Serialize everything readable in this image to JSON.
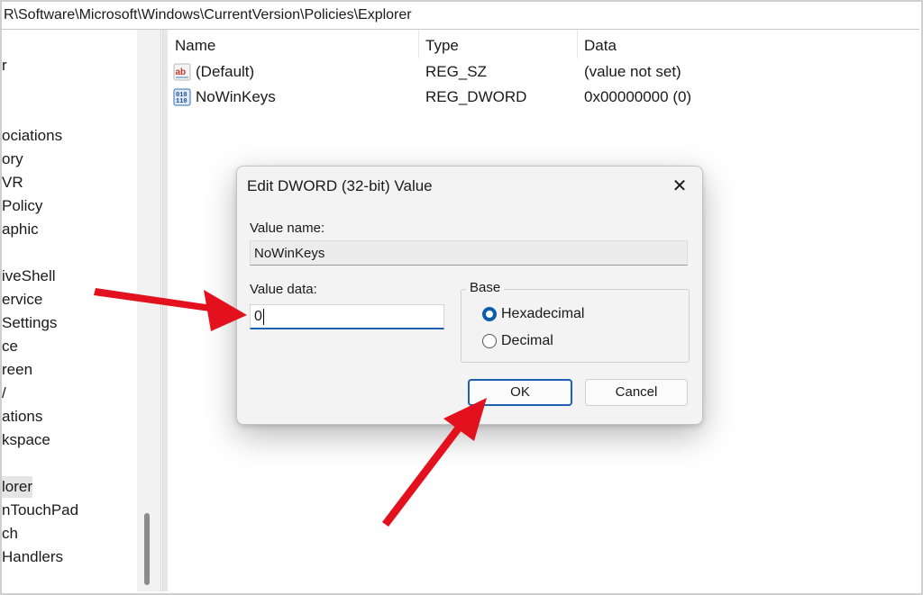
{
  "address_path": "R\\Software\\Microsoft\\Windows\\CurrentVersion\\Policies\\Explorer",
  "tree_items": [
    "r",
    "ociations",
    "ory",
    "VR",
    "Policy",
    "aphic",
    "iveShell",
    "ervice",
    " Settings",
    "ce",
    "reen",
    "/",
    "ations",
    "kspace",
    "lorer",
    "nTouchPad",
    "ch",
    " Handlers"
  ],
  "selected_tree_item": "lorer",
  "list": {
    "columns": [
      "Name",
      "Type",
      "Data"
    ],
    "rows": [
      {
        "icon": "string-value-icon",
        "name": "(Default)",
        "type": "REG_SZ",
        "data": "(value not set)"
      },
      {
        "icon": "binary-value-icon",
        "name": "NoWinKeys",
        "type": "REG_DWORD",
        "data": "0x00000000 (0)"
      }
    ]
  },
  "dialog": {
    "title": "Edit DWORD (32-bit) Value",
    "close_glyph": "✕",
    "value_name_label": "Value name:",
    "value_name": "NoWinKeys",
    "value_data_label": "Value data:",
    "value_data": "0",
    "base_label": "Base",
    "base_options": [
      "Hexadecimal",
      "Decimal"
    ],
    "base_selected": "Hexadecimal",
    "ok_label": "OK",
    "cancel_label": "Cancel"
  },
  "colors": {
    "annotation_arrow": "#e3101d",
    "accent": "#0b5cab"
  }
}
